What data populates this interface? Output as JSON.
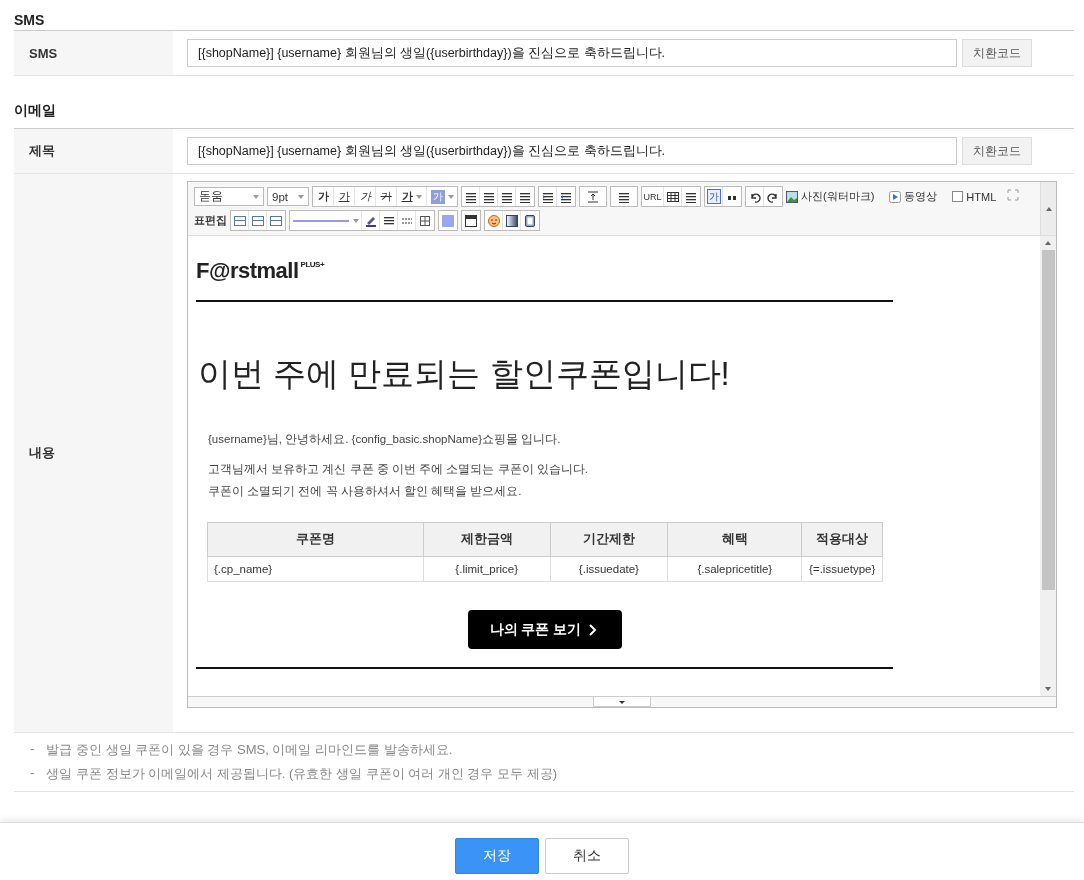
{
  "sms_section": {
    "title": "SMS",
    "label": "SMS",
    "value": "[{shopName}] {username} 회원님의 생일({userbirthday})을 진심으로 축하드립니다.",
    "code_button": "치환코드"
  },
  "email_section": {
    "title": "이메일",
    "subject_label": "제목",
    "subject_value": "[{shopName}] {username} 회원님의 생일({userbirthday})을 진심으로 축하드립니다.",
    "code_button": "치환코드",
    "content_label": "내용"
  },
  "editor": {
    "font": "돋움",
    "size": "9pt",
    "text_style_buttons": [
      {
        "kind": "bold",
        "label": "가"
      },
      {
        "kind": "underline",
        "label": "가"
      },
      {
        "kind": "italic",
        "label": "가"
      },
      {
        "kind": "strike",
        "label": "가"
      },
      {
        "kind": "color",
        "label": "가"
      },
      {
        "kind": "highlight",
        "label": "가"
      }
    ],
    "url_button": "URL",
    "special_char_button": "가",
    "photo_button": "사진(워터마크)",
    "video_button": "동영상",
    "html_toggle": {
      "label": "HTML",
      "checked": false
    },
    "table_edit_label": "표편집"
  },
  "email_body": {
    "logo": "F@rstmall",
    "logo_badge": "PLUS+",
    "heading": "이번 주에 만료되는 할인쿠폰입니다!",
    "greeting": "{username}님, 안녕하세요. {config_basic.shopName}쇼핑몰 입니다.",
    "message_lines": [
      "고객님께서 보유하고 계신 쿠폰 중 이번 주에 소멸되는 쿠폰이 있습니다.",
      "쿠폰이 소멸되기 전에 꼭 사용하셔서 할인 혜택을 받으세요."
    ],
    "coupon_table": {
      "columns": [
        "쿠폰명",
        "제한금액",
        "기간제한",
        "혜택",
        "적용대상"
      ],
      "rows": [
        [
          "{.cp_name}",
          "{.limit_price}",
          "{.issuedate}",
          "{.salepricetitle}",
          "{=.issuetype}"
        ]
      ]
    },
    "cta_button": "나의 쿠폰 보기"
  },
  "notes": [
    "발급 중인 생일 쿠폰이 있을 경우 SMS, 이메일 리마인드를 발송하세요.",
    "생일 쿠폰 정보가 이메일에서 제공됩니다. (유효한 생일 쿠폰이 여러 개인 경우 모두 제공)"
  ],
  "note_bullet": "-",
  "footer": {
    "save_button": "저장",
    "cancel_button": "취소"
  }
}
